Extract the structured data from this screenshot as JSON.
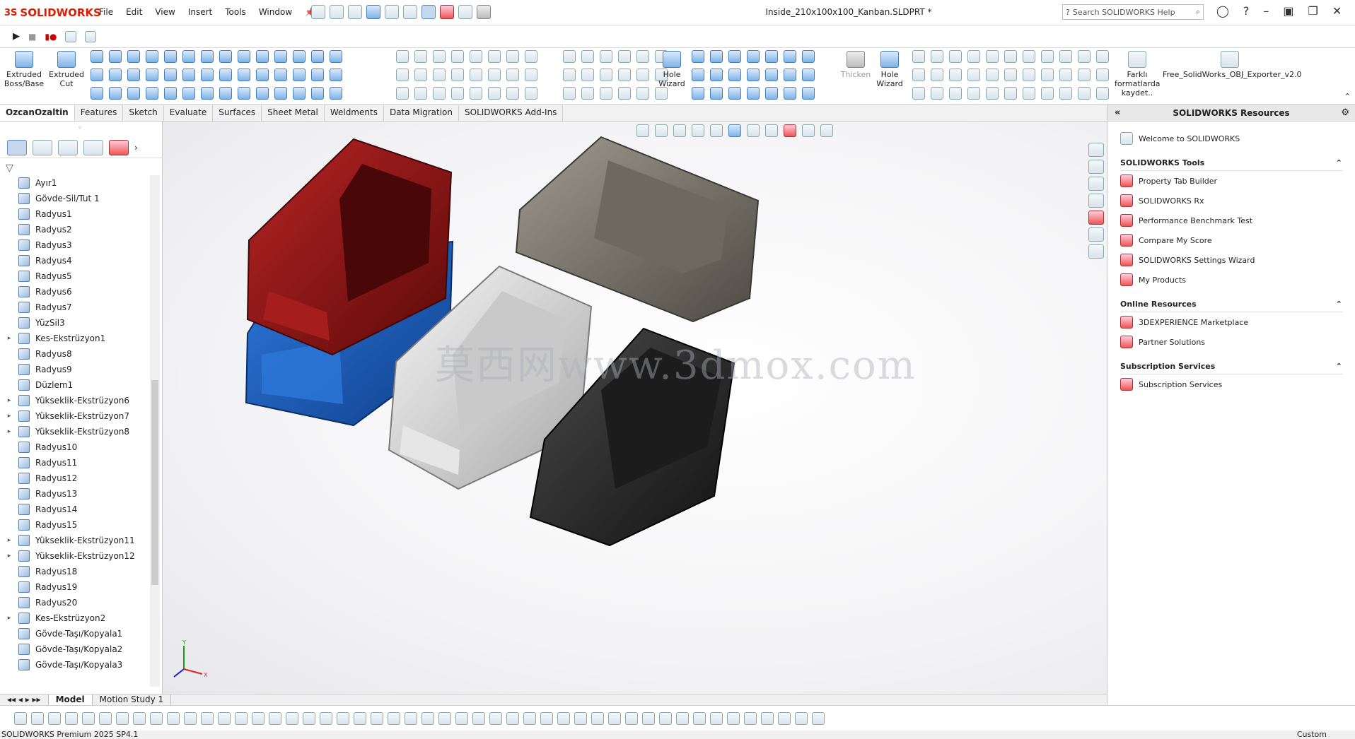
{
  "app": {
    "brand_ds": "3S",
    "brand_name": "SOLIDWORKS",
    "doc_title": "Inside_210x100x100_Kanban.SLDPRT *"
  },
  "menu": [
    "File",
    "Edit",
    "View",
    "Insert",
    "Tools",
    "Window"
  ],
  "search": {
    "placeholder": "Search SOLIDWORKS Help"
  },
  "command_manager": {
    "extruded_boss": "Extruded Boss/Base",
    "extruded_cut": "Extruded Cut",
    "hole_wizard_1": "Hole Wizard",
    "thicken": "Thicken",
    "hole_wizard_2": "Hole Wizard",
    "farkli": "Farklı formatlarda kaydet..",
    "obj_exporter": "Free_SolidWorks_OBJ_Exporter_v2.0"
  },
  "tabs": [
    "OzcanOzaltin",
    "Features",
    "Sketch",
    "Evaluate",
    "Surfaces",
    "Sheet Metal",
    "Weldments",
    "Data Migration",
    "SOLIDWORKS Add-Ins"
  ],
  "feature_tree": [
    {
      "label": "Ayır1",
      "expand": false
    },
    {
      "label": "Gövde-Sil/Tut 1",
      "expand": false
    },
    {
      "label": "Radyus1",
      "expand": false
    },
    {
      "label": "Radyus2",
      "expand": false
    },
    {
      "label": "Radyus3",
      "expand": false
    },
    {
      "label": "Radyus4",
      "expand": false
    },
    {
      "label": "Radyus5",
      "expand": false
    },
    {
      "label": "Radyus6",
      "expand": false
    },
    {
      "label": "Radyus7",
      "expand": false
    },
    {
      "label": "YüzSil3",
      "expand": false
    },
    {
      "label": "Kes-Ekstrüzyon1",
      "expand": true
    },
    {
      "label": "Radyus8",
      "expand": false
    },
    {
      "label": "Radyus9",
      "expand": false
    },
    {
      "label": "Düzlem1",
      "expand": false
    },
    {
      "label": "Yükseklik-Ekstrüzyon6",
      "expand": true
    },
    {
      "label": "Yükseklik-Ekstrüzyon7",
      "expand": true
    },
    {
      "label": "Yükseklik-Ekstrüzyon8",
      "expand": true
    },
    {
      "label": "Radyus10",
      "expand": false
    },
    {
      "label": "Radyus11",
      "expand": false
    },
    {
      "label": "Radyus12",
      "expand": false
    },
    {
      "label": "Radyus13",
      "expand": false
    },
    {
      "label": "Radyus14",
      "expand": false
    },
    {
      "label": "Radyus15",
      "expand": false
    },
    {
      "label": "Yükseklik-Ekstrüzyon11",
      "expand": true
    },
    {
      "label": "Yükseklik-Ekstrüzyon12",
      "expand": true
    },
    {
      "label": "Radyus18",
      "expand": false
    },
    {
      "label": "Radyus19",
      "expand": false
    },
    {
      "label": "Radyus20",
      "expand": false
    },
    {
      "label": "Kes-Ekstrüzyon2",
      "expand": true
    },
    {
      "label": "Gövde-Taşı/Kopyala1",
      "expand": false
    },
    {
      "label": "Gövde-Taşı/Kopyala2",
      "expand": false
    },
    {
      "label": "Gövde-Taşı/Kopyala3",
      "expand": false
    }
  ],
  "bottom_tabs": [
    "Model",
    "Motion Study 1"
  ],
  "status": {
    "left": "SOLIDWORKS Premium 2025 SP4.1",
    "right": "Custom"
  },
  "viewport": {
    "watermark": "莫西网www.3dmox.com",
    "bin_colors": {
      "red": "#8f1616",
      "blue": "#1c5fc4",
      "white": "#dcdcdc",
      "gray": "#7d7a70",
      "black": "#2a2a2a"
    },
    "triad": {
      "x": "X",
      "y": "Y"
    }
  },
  "task_pane": {
    "title": "SOLIDWORKS Resources",
    "welcome": "Welcome to SOLIDWORKS",
    "tools_header": "SOLIDWORKS Tools",
    "tools": [
      "Property Tab Builder",
      "SOLIDWORKS Rx",
      "Performance Benchmark Test",
      "Compare My Score",
      "SOLIDWORKS Settings Wizard",
      "My Products"
    ],
    "online_header": "Online Resources",
    "online": [
      "3DEXPERIENCE Marketplace",
      "Partner Solutions"
    ],
    "subscription_header": "Subscription Services",
    "subscription": [
      "Subscription Services"
    ]
  }
}
